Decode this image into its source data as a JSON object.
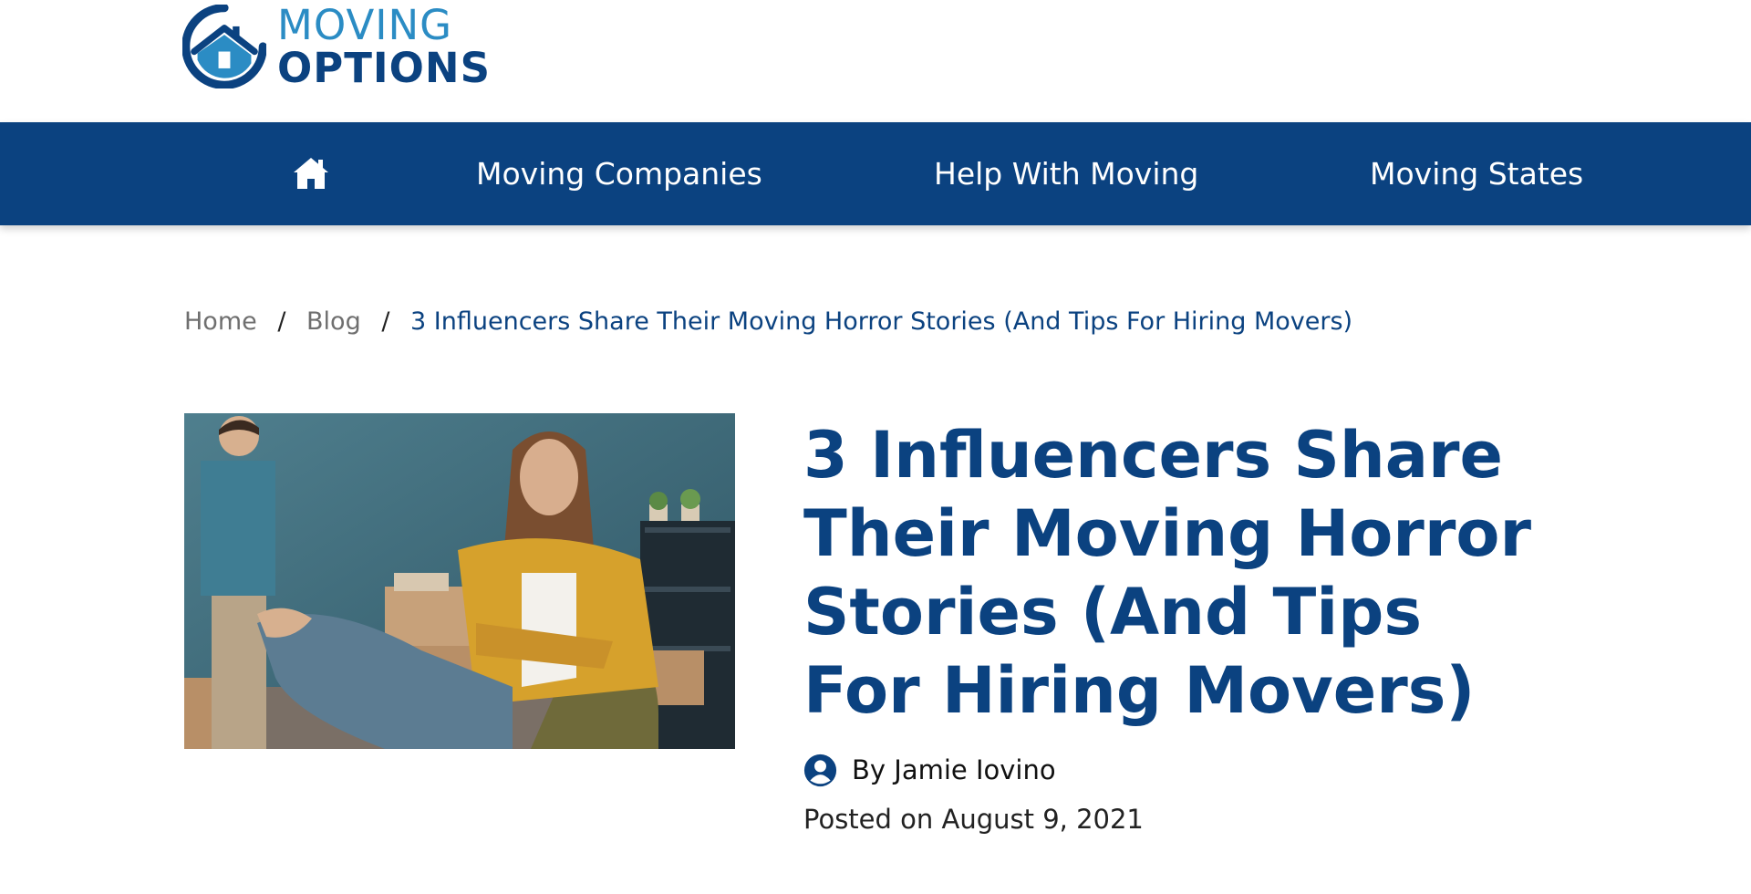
{
  "header": {
    "logo": {
      "line1": "MOVING",
      "line2": "OPTIONS",
      "icon": "house-circle-logo-icon"
    }
  },
  "nav": {
    "home_icon": "home-icon",
    "items": [
      {
        "label": "Moving Companies"
      },
      {
        "label": "Help With Moving"
      },
      {
        "label": "Moving States"
      }
    ]
  },
  "breadcrumb": {
    "items": [
      "Home",
      "Blog"
    ],
    "separator": "/",
    "current": "3 Influencers Share Their Moving Horror Stories (And Tips For Hiring Movers)"
  },
  "article": {
    "image": "woman-in-yellow-shirt-sitting-arms-crossed-man-standing-moving-boxes-photo",
    "title": "3 Influencers Share Their Moving Horror Stories (And Tips For Hiring Movers)",
    "author_icon": "user-circle-icon",
    "author": "By Jamie Iovino",
    "posted": "Posted on August 9, 2021"
  },
  "colors": {
    "brand_navy": "#0b4280",
    "brand_light_blue": "#2b8cc4",
    "breadcrumb_gray": "#6f6f6f"
  }
}
